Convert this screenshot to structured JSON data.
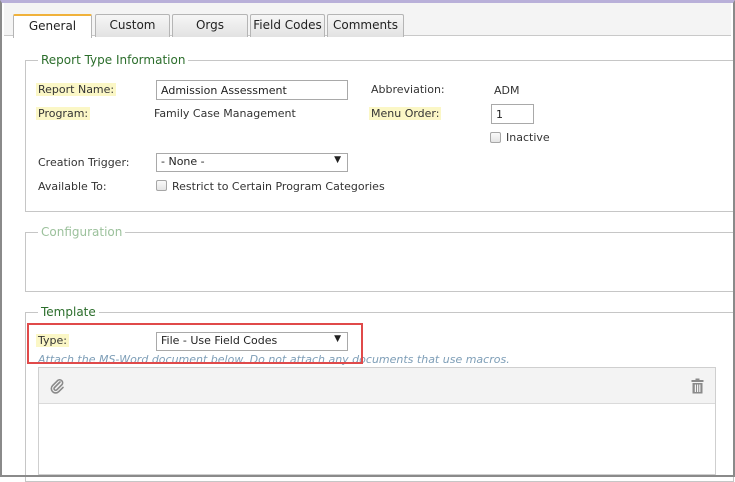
{
  "tabs": [
    {
      "label": "General"
    },
    {
      "label": "Custom"
    },
    {
      "label": "Orgs"
    },
    {
      "label": "Field Codes"
    },
    {
      "label": "Comments"
    }
  ],
  "report_type": {
    "legend": "Report Type Information",
    "report_name_label": "Report Name:",
    "report_name_value": "Admission Assessment",
    "program_label": "Program:",
    "program_value": "Family Case Management",
    "abbreviation_label": "Abbreviation:",
    "abbreviation_value": "ADM",
    "menu_order_label": "Menu Order:",
    "menu_order_value": "1",
    "inactive_label": "Inactive",
    "creation_trigger_label": "Creation Trigger:",
    "creation_trigger_value": "- None -",
    "available_to_label": "Available To:",
    "restrict_label": "Restrict to Certain Program Categories"
  },
  "configuration": {
    "legend": "Configuration"
  },
  "template": {
    "legend": "Template",
    "type_label": "Type:",
    "type_value": "File - Use Field Codes",
    "hint": "Attach the MS-Word document below. Do not attach any documents that use macros."
  },
  "icons": {
    "attach": "paperclip-icon",
    "delete": "trash-icon",
    "dropdown": "triangle-down-icon"
  },
  "colors": {
    "active_tab_accent": "#f0b23b",
    "legend_green": "#2c6e2c",
    "required_highlight": "#fbf7c6",
    "callout_red": "#e04a4a",
    "hint_blue": "#7e9eb7"
  }
}
